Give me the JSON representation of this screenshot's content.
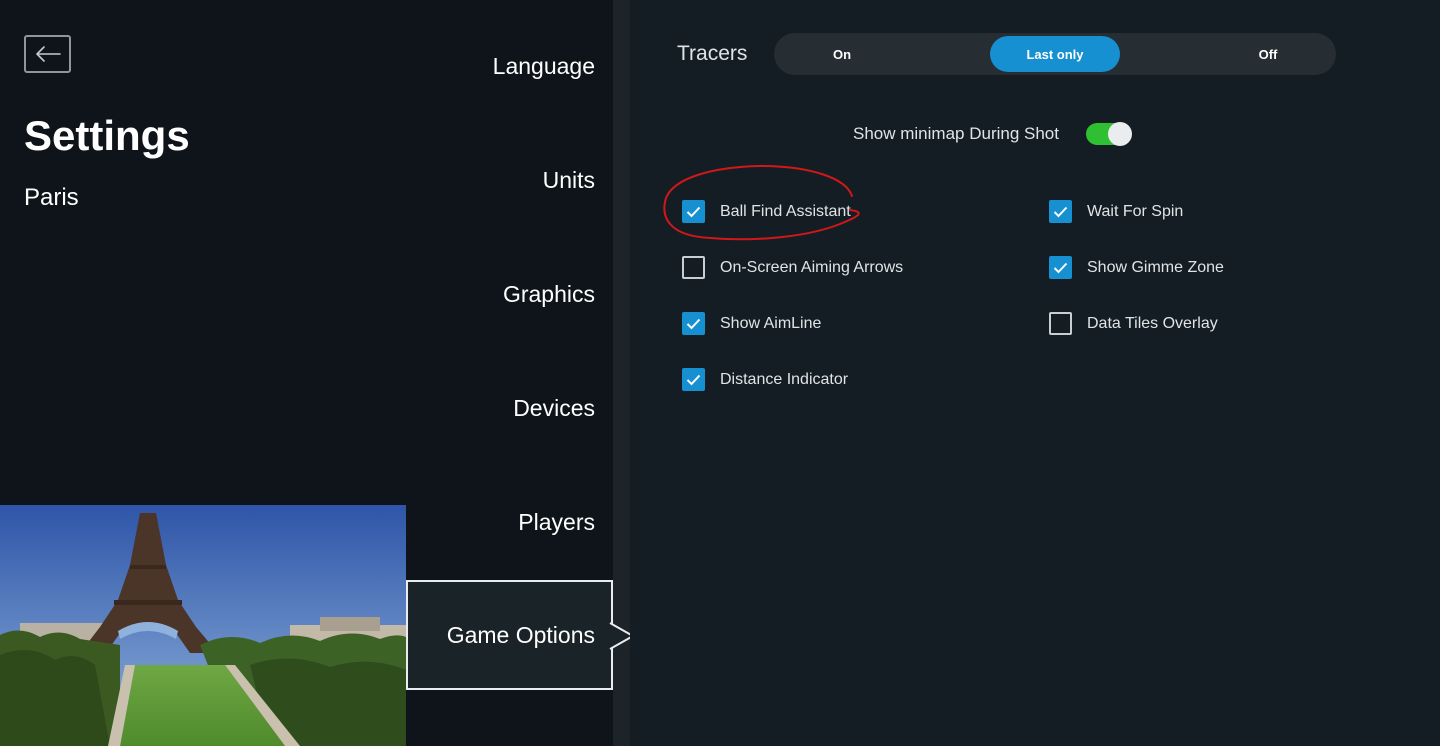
{
  "header": {
    "title": "Settings",
    "subtitle": "Paris"
  },
  "sidebar": {
    "items": [
      {
        "label": "Language"
      },
      {
        "label": "Units"
      },
      {
        "label": "Graphics"
      },
      {
        "label": "Devices"
      },
      {
        "label": "Players"
      },
      {
        "label": "Game Options",
        "active": true
      }
    ]
  },
  "game_options": {
    "tracers": {
      "label": "Tracers",
      "options": [
        "On",
        "Last only",
        "Off"
      ],
      "selected": "Last only"
    },
    "minimap": {
      "label": "Show minimap During Shot",
      "enabled": true
    },
    "checkboxes": [
      {
        "label": "Ball Find Assistant",
        "checked": true
      },
      {
        "label": "On-Screen Aiming Arrows",
        "checked": false
      },
      {
        "label": "Show AimLine",
        "checked": true
      },
      {
        "label": "Distance Indicator",
        "checked": true
      },
      {
        "label": "Wait For Spin",
        "checked": true
      },
      {
        "label": "Show Gimme Zone",
        "checked": true
      },
      {
        "label": "Data Tiles Overlay",
        "checked": false
      }
    ]
  },
  "icons": {
    "back": "arrow-left-icon",
    "check": "checkmark-icon"
  },
  "colors": {
    "accent": "#1690d0",
    "toggle_on": "#2fbf33",
    "annotation": "#d01818"
  }
}
